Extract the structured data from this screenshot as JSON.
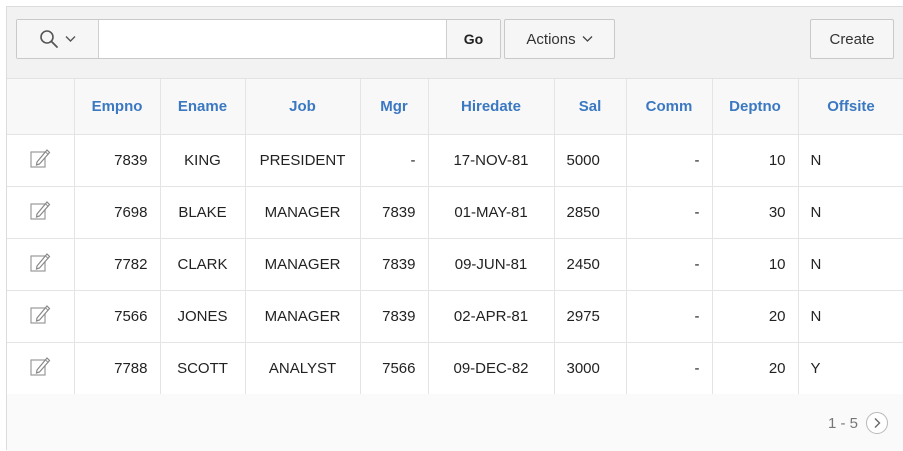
{
  "toolbar": {
    "search_icon": "search-icon",
    "search_value": "",
    "go_label": "Go",
    "actions_label": "Actions",
    "create_label": "Create"
  },
  "table": {
    "columns": [
      "",
      "Empno",
      "Ename",
      "Job",
      "Mgr",
      "Hiredate",
      "Sal",
      "Comm",
      "Deptno",
      "Offsite"
    ],
    "rows": [
      [
        "7839",
        "KING",
        "PRESIDENT",
        "-",
        "17-NOV-81",
        "5000",
        "-",
        "10",
        "N"
      ],
      [
        "7698",
        "BLAKE",
        "MANAGER",
        "7839",
        "01-MAY-81",
        "2850",
        "-",
        "30",
        "N"
      ],
      [
        "7782",
        "CLARK",
        "MANAGER",
        "7839",
        "09-JUN-81",
        "2450",
        "-",
        "10",
        "N"
      ],
      [
        "7566",
        "JONES",
        "MANAGER",
        "7839",
        "02-APR-81",
        "2975",
        "-",
        "20",
        "N"
      ],
      [
        "7788",
        "SCOTT",
        "ANALYST",
        "7566",
        "09-DEC-82",
        "3000",
        "-",
        "20",
        "Y"
      ]
    ]
  },
  "pagination": {
    "range": "1 - 5"
  },
  "colors": {
    "header_text": "#3b78c2",
    "toolbar_bg": "#f2f2f2",
    "border": "#e4e4e4"
  }
}
